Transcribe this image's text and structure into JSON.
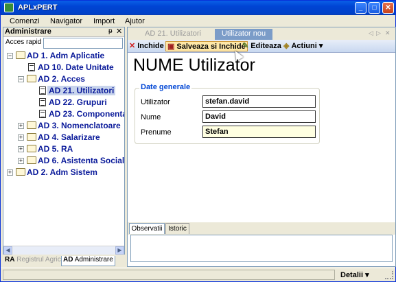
{
  "window": {
    "title": "APLxPERT",
    "minimize": "_",
    "maximize": "□",
    "close": "✕"
  },
  "menu": [
    "Comenzi",
    "Navigator",
    "Import",
    "Ajutor"
  ],
  "left_panel": {
    "title": "Administrare",
    "pin": "ᵽ",
    "close": "✕",
    "quick_access_label": "Acces rapid",
    "quick_access_value": "",
    "tree": [
      {
        "label": "AD 1. Adm Aplicatie",
        "icon": "folder-open-icon",
        "expanded": true
      },
      {
        "label": "AD 10. Date Unitate",
        "icon": "document-icon"
      },
      {
        "label": "AD 2. Acces",
        "icon": "folder-open-icon",
        "expanded": true
      },
      {
        "label": "AD 21. Utilizatori",
        "icon": "document-icon",
        "selected": true
      },
      {
        "label": "AD 22. Grupuri",
        "icon": "document-icon"
      },
      {
        "label": "AD 23. Componenta",
        "icon": "document-icon"
      },
      {
        "label": "AD 3. Nomenclatoare",
        "icon": "folder-icon",
        "expanded": false
      },
      {
        "label": "AD 4. Salarizare",
        "icon": "folder-icon",
        "expanded": false
      },
      {
        "label": "AD 5. RA",
        "icon": "folder-icon",
        "expanded": false
      },
      {
        "label": "AD 6. Asistenta Sociala",
        "icon": "folder-icon",
        "expanded": false
      },
      {
        "label": "AD 2. Adm Sistem",
        "icon": "folder-icon",
        "expanded": false
      }
    ],
    "bottom_tabs": [
      {
        "prefix": "RA",
        "label": "Registrul Agricol",
        "active": false
      },
      {
        "prefix": "AD",
        "label": "Administrare",
        "active": true
      }
    ]
  },
  "doc_tabs": [
    {
      "label": "AD 21. Utilizatori",
      "active": false
    },
    {
      "label": "Utilizator nou",
      "active": true
    }
  ],
  "tab_nav": [
    "◁",
    "▷",
    "✕"
  ],
  "toolbar": {
    "close_label": "Inchide",
    "save_close_label": "Salveaza si Inchide",
    "edit_label": "Editeaza",
    "actions_label": "Actiuni",
    "actions_arrow": "▾"
  },
  "form": {
    "heading": "NUME Utilizator",
    "group_title": "Date generale",
    "fields": [
      {
        "label": "Utilizator",
        "value": "stefan.david"
      },
      {
        "label": "Nume",
        "value": "David"
      },
      {
        "label": "Prenume",
        "value": "Stefan"
      }
    ]
  },
  "bottom_tabs": [
    {
      "label": "Observatii",
      "active": true
    },
    {
      "label": "Istoric",
      "active": false
    }
  ],
  "observations": "",
  "status_bar": {
    "text": "",
    "details_label": "Detalii",
    "details_arrow": "▾"
  },
  "colors": {
    "accent": "#0046d5",
    "tree_text": "#0a1a9a",
    "highlight": "#ffe8a8",
    "field_yellow": "#ffffe1"
  }
}
